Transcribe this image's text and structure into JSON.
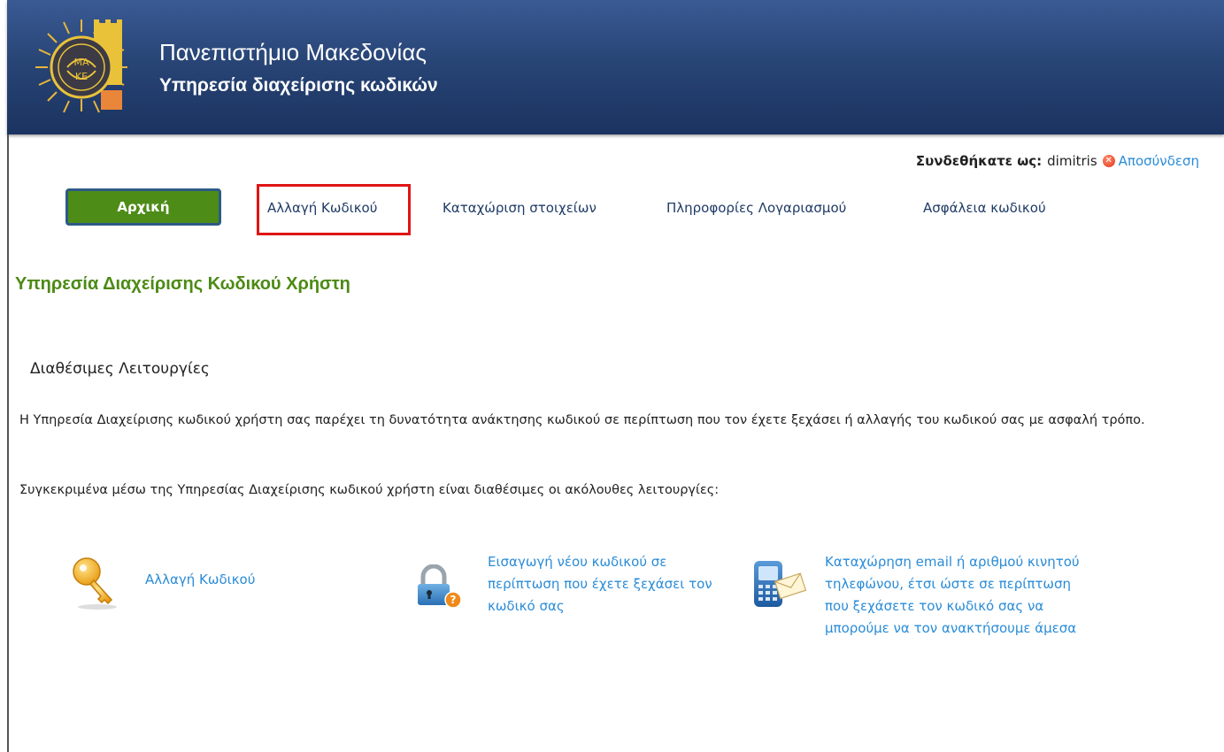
{
  "header": {
    "title": "Πανεπιστήμιο Μακεδονίας",
    "subtitle": "Υπηρεσία διαχείρισης κωδικών",
    "logo_icon": "university-logo-sun-icon",
    "background_color": "#284576"
  },
  "login": {
    "label": "Συνδεθήκατε ως:",
    "username": "dimitris",
    "logout_icon": "close-circle-icon",
    "logout_label": "Αποσύνδεση"
  },
  "nav": {
    "items": [
      {
        "label": "Αρχική"
      },
      {
        "label": "Αλλαγή Κωδικού"
      },
      {
        "label": "Καταχώριση στοιχείων"
      },
      {
        "label": "Πληροφορίες Λογαριασμού"
      },
      {
        "label": "Ασφάλεια κωδικού"
      }
    ],
    "active_color": "#4e8c18",
    "highlight_color": "#e01414"
  },
  "main": {
    "heading": "Υπηρεσία Διαχείρισης Κωδικού Χρήστη",
    "section_title": "Διαθέσιμες Λειτουργίες",
    "paragraph1": "Η Υπηρεσία Διαχείρισης κωδικού χρήστη σας παρέχει τη δυνατότητα ανάκτησης κωδικού σε περίπτωση που τον έχετε ξεχάσει ή αλλαγής του κωδικού σας με ασφαλή τρόπο.",
    "paragraph2": "Συγκεκριμένα μέσω της Υπηρεσίας Διαχείρισης κωδικού χρήστη είναι διαθέσιμες οι ακόλουθες λειτουργίες:",
    "features": [
      {
        "icon": "key-icon",
        "label": "Αλλαγή Κωδικού"
      },
      {
        "icon": "padlock-help-icon",
        "label": "Εισαγωγή νέου κωδικού σε περίπτωση που έχετε ξεχάσει τον κωδικό σας"
      },
      {
        "icon": "phone-email-icon",
        "label": "Καταχώρηση email ή αριθμού κινητού τηλεφώνου, έτσι ώστε σε περίπτωση που ξεχάσετε τον κωδικό σας να μπορούμε να τον ανακτήσουμε άμεσα"
      }
    ]
  }
}
